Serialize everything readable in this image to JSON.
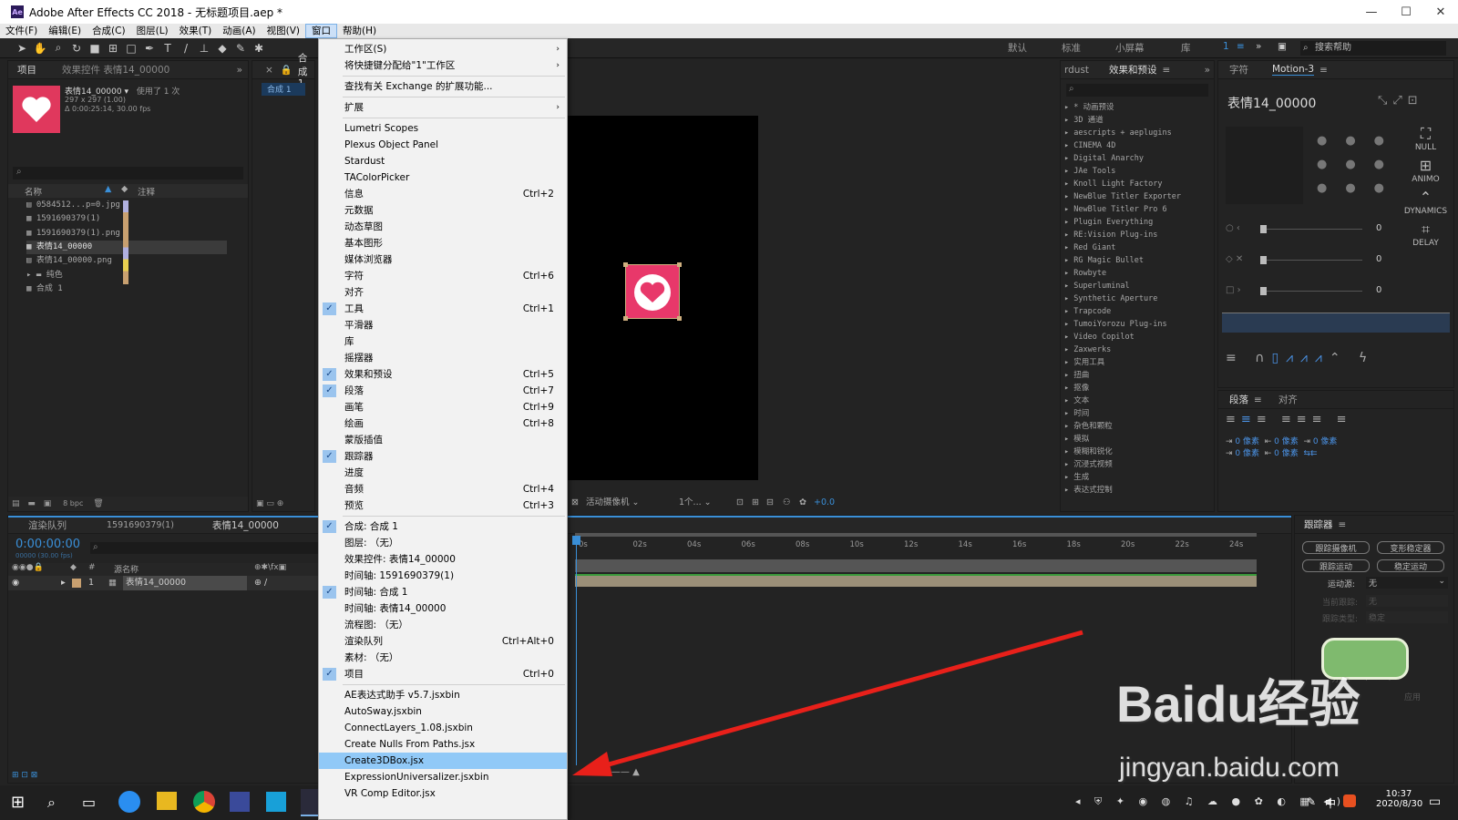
{
  "window": {
    "app_badge": "Ae",
    "title": "Adobe After Effects CC 2018 - 无标题项目.aep *"
  },
  "menubar": [
    "文件(F)",
    "编辑(E)",
    "合成(C)",
    "图层(L)",
    "效果(T)",
    "动画(A)",
    "视图(V)",
    "窗口",
    "帮助(H)"
  ],
  "workspaces": [
    "默认",
    "标准",
    "小屏幕",
    "库"
  ],
  "search_help": "搜索帮助",
  "project_panel": {
    "tabs": [
      "项目",
      "效果控件 表情14_00000"
    ],
    "selected_name": "表情14_00000 ▾",
    "used_count": "使用了 1 次",
    "dims": "297 x 297 (1.00)",
    "duration": "Δ 0:00:25:14, 30.00 fps",
    "col_name": "名称",
    "col_comment": "注释",
    "items": [
      "0584512...p=0.jpg",
      "1591690379(1)",
      "1591690379(1).png",
      "表情14_00000",
      "表情14_00000.png",
      "纯色",
      "合成 1"
    ],
    "bpc": "8 bpc"
  },
  "composition": {
    "tab": "合成 1",
    "camera": "活动摄像机",
    "views": "1个...",
    "exposure": "+0.0"
  },
  "effects_panel": {
    "tabs": [
      "rdust",
      "效果和预设"
    ],
    "items": [
      "* 动画预设",
      "3D 通道",
      "aescripts + aeplugins",
      "CINEMA 4D",
      "Digital Anarchy",
      "JAe Tools",
      "Knoll Light Factory",
      "NewBlue Titler Exporter",
      "NewBlue Titler Pro 6",
      "Plugin Everything",
      "RE:Vision Plug-ins",
      "Red Giant",
      "RG Magic Bullet",
      "Rowbyte",
      "Superluminal",
      "Synthetic Aperture",
      "Trapcode",
      "TumoiYorozu Plug-ins",
      "Video Copilot",
      "Zaxwerks",
      "实用工具",
      "扭曲",
      "抠像",
      "文本",
      "时间",
      "杂色和颗粒",
      "模拟",
      "模糊和锐化",
      "沉浸式视频",
      "生成",
      "表达式控制"
    ]
  },
  "motion_panel": {
    "tabs": [
      "字符",
      "Motion-3"
    ],
    "layer_name": "表情14_00000",
    "buttons": [
      "NULL",
      "ANIMO",
      "DYNAMICS",
      "DELAY"
    ],
    "slider_values": [
      "0",
      "0",
      "0"
    ]
  },
  "paragraph_panel": {
    "tabs": [
      "段落",
      "对齐"
    ],
    "indent_values": [
      "0 像素",
      "0 像素",
      "0 像素",
      "0 像素",
      "0 像素"
    ]
  },
  "tracker_panel": {
    "title": "跟踪器",
    "buttons": [
      "跟踪摄像机",
      "变形稳定器",
      "跟踪运动",
      "稳定运动"
    ],
    "motion_source_label": "运动源:",
    "motion_source_value": "无",
    "current_track_label": "当前跟踪:",
    "current_track_value": "无",
    "track_type_label": "跟踪类型:",
    "track_type_value": "稳定",
    "analyze_label": "分析:",
    "apply_label": "应用"
  },
  "timeline": {
    "tabs": [
      "渲染队列",
      "1591690379(1)",
      "表情14_00000"
    ],
    "timecode": "0:00:00:00",
    "fps": "00000 (30.00 fps)",
    "col_source": "源名称",
    "layer_index": "1",
    "layer_name": "表情14_00000",
    "ruler": [
      "0s",
      "02s",
      "04s",
      "06s",
      "08s",
      "10s",
      "12s",
      "14s",
      "16s",
      "18s",
      "20s",
      "22s",
      "24s"
    ]
  },
  "window_menu": {
    "items": [
      {
        "label": "工作区(S)",
        "submenu": true
      },
      {
        "label": "将快捷键分配给\"1\"工作区",
        "submenu": true
      },
      {
        "sep": true
      },
      {
        "label": "查找有关 Exchange 的扩展功能..."
      },
      {
        "sep": true
      },
      {
        "label": "扩展",
        "submenu": true
      },
      {
        "sep": true
      },
      {
        "label": "Lumetri Scopes"
      },
      {
        "label": "Plexus Object Panel"
      },
      {
        "label": "Stardust"
      },
      {
        "label": "TAColorPicker"
      },
      {
        "label": "信息",
        "shortcut": "Ctrl+2"
      },
      {
        "label": "元数据"
      },
      {
        "label": "动态草图"
      },
      {
        "label": "基本图形"
      },
      {
        "label": "媒体浏览器"
      },
      {
        "label": "字符",
        "shortcut": "Ctrl+6"
      },
      {
        "label": "对齐"
      },
      {
        "label": "工具",
        "shortcut": "Ctrl+1",
        "checked": true
      },
      {
        "label": "平滑器"
      },
      {
        "label": "库"
      },
      {
        "label": "摇摆器"
      },
      {
        "label": "效果和预设",
        "shortcut": "Ctrl+5",
        "checked": true
      },
      {
        "label": "段落",
        "shortcut": "Ctrl+7",
        "checked": true
      },
      {
        "label": "画笔",
        "shortcut": "Ctrl+9"
      },
      {
        "label": "绘画",
        "shortcut": "Ctrl+8"
      },
      {
        "label": "蒙版插值"
      },
      {
        "label": "跟踪器",
        "checked": true
      },
      {
        "label": "进度"
      },
      {
        "label": "音频",
        "shortcut": "Ctrl+4"
      },
      {
        "label": "预览",
        "shortcut": "Ctrl+3"
      },
      {
        "sep": true
      },
      {
        "label": "合成: 合成 1",
        "checked": true
      },
      {
        "label": "图层: （无）"
      },
      {
        "label": "效果控件: 表情14_00000"
      },
      {
        "label": "时间轴: 1591690379(1)"
      },
      {
        "label": "时间轴: 合成 1",
        "checked": true
      },
      {
        "label": "时间轴: 表情14_00000"
      },
      {
        "label": "流程图: （无）"
      },
      {
        "label": "渲染队列",
        "shortcut": "Ctrl+Alt+0"
      },
      {
        "label": "素材: （无）"
      },
      {
        "label": "项目",
        "shortcut": "Ctrl+0",
        "checked": true
      },
      {
        "sep": true
      },
      {
        "label": "AE表达式助手 v5.7.jsxbin"
      },
      {
        "label": "AutoSway.jsxbin"
      },
      {
        "label": "ConnectLayers_1.08.jsxbin"
      },
      {
        "label": "Create Nulls From Paths.jsx"
      },
      {
        "label": "Create3DBox.jsx",
        "highlighted": true
      },
      {
        "label": "ExpressionUniversalizer.jsxbin"
      },
      {
        "label": "VR Comp Editor.jsx"
      }
    ]
  },
  "watermark": {
    "brand": "Baidu经验",
    "url": "jingyan.baidu.com"
  },
  "taskbar": {
    "time": "10:37",
    "date": "2020/8/30",
    "ime": "中"
  }
}
